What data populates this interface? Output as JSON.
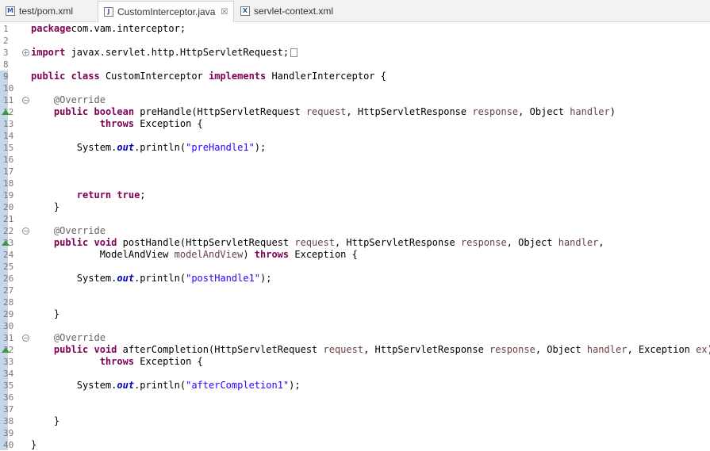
{
  "tabs": [
    {
      "label": "test/pom.xml",
      "icon": "maven-pom-icon",
      "active": false
    },
    {
      "label": "CustomInterceptor.java",
      "icon": "java-file-icon",
      "active": true,
      "close": "☒"
    },
    {
      "label": "servlet-context.xml",
      "icon": "xml-file-icon",
      "active": false
    }
  ],
  "editor": {
    "lines": [
      {
        "n": "1",
        "tokens": [
          [
            "kw",
            "package"
          ],
          [
            "",
            "com.vam.interceptor;"
          ]
        ]
      },
      {
        "n": "2",
        "tokens": []
      },
      {
        "n": "3",
        "fold": "expand",
        "tokens": [
          [
            "kw",
            "import"
          ],
          [
            "",
            " javax.servlet.http.HttpServletRequest;"
          ]
        ],
        "folded": true
      },
      {
        "n": "8",
        "tokens": []
      },
      {
        "n": "9",
        "tokens": [
          [
            "kw",
            "public"
          ],
          [
            "",
            " "
          ],
          [
            "kw",
            "class"
          ],
          [
            "",
            " CustomInterceptor "
          ],
          [
            "kw",
            "implements"
          ],
          [
            "",
            " HandlerInterceptor {"
          ]
        ]
      },
      {
        "n": "10",
        "tokens": []
      },
      {
        "n": "11",
        "fold": "collapse",
        "tokens": [
          [
            "",
            "    "
          ],
          [
            "ann",
            "@Override"
          ]
        ]
      },
      {
        "n": "12",
        "override": true,
        "tokens": [
          [
            "",
            "    "
          ],
          [
            "kw",
            "public"
          ],
          [
            "",
            " "
          ],
          [
            "kw",
            "boolean"
          ],
          [
            "",
            " preHandle(HttpServletRequest "
          ],
          [
            "param",
            "request"
          ],
          [
            "",
            ", HttpServletResponse "
          ],
          [
            "param",
            "response"
          ],
          [
            "",
            ", Object "
          ],
          [
            "param",
            "handler"
          ],
          [
            "",
            ")"
          ]
        ]
      },
      {
        "n": "13",
        "tokens": [
          [
            "",
            "            "
          ],
          [
            "kw",
            "throws"
          ],
          [
            "",
            " Exception {"
          ]
        ]
      },
      {
        "n": "14",
        "tokens": []
      },
      {
        "n": "15",
        "tokens": [
          [
            "",
            "        System."
          ],
          [
            "field",
            "out"
          ],
          [
            "",
            ".println("
          ],
          [
            "str",
            "\"preHandle1\""
          ],
          [
            "",
            ");"
          ]
        ]
      },
      {
        "n": "16",
        "tokens": []
      },
      {
        "n": "17",
        "tokens": []
      },
      {
        "n": "18",
        "tokens": []
      },
      {
        "n": "19",
        "tokens": [
          [
            "",
            "        "
          ],
          [
            "kw",
            "return"
          ],
          [
            "",
            " "
          ],
          [
            "kw",
            "true"
          ],
          [
            "",
            ";"
          ]
        ]
      },
      {
        "n": "20",
        "tokens": [
          [
            "",
            "    }"
          ]
        ]
      },
      {
        "n": "21",
        "tokens": []
      },
      {
        "n": "22",
        "fold": "collapse",
        "tokens": [
          [
            "",
            "    "
          ],
          [
            "ann",
            "@Override"
          ]
        ]
      },
      {
        "n": "23",
        "override": true,
        "tokens": [
          [
            "",
            "    "
          ],
          [
            "kw",
            "public"
          ],
          [
            "",
            " "
          ],
          [
            "kw",
            "void"
          ],
          [
            "",
            " postHandle(HttpServletRequest "
          ],
          [
            "param",
            "request"
          ],
          [
            "",
            ", HttpServletResponse "
          ],
          [
            "param",
            "response"
          ],
          [
            "",
            ", Object "
          ],
          [
            "param",
            "handler"
          ],
          [
            "",
            ","
          ]
        ]
      },
      {
        "n": "24",
        "tokens": [
          [
            "",
            "            ModelAndView "
          ],
          [
            "param",
            "modelAndView"
          ],
          [
            "",
            ") "
          ],
          [
            "kw",
            "throws"
          ],
          [
            "",
            " Exception {"
          ]
        ]
      },
      {
        "n": "25",
        "tokens": []
      },
      {
        "n": "26",
        "tokens": [
          [
            "",
            "        System."
          ],
          [
            "field",
            "out"
          ],
          [
            "",
            ".println("
          ],
          [
            "str",
            "\"postHandle1\""
          ],
          [
            "",
            ");"
          ]
        ]
      },
      {
        "n": "27",
        "tokens": []
      },
      {
        "n": "28",
        "tokens": []
      },
      {
        "n": "29",
        "tokens": [
          [
            "",
            "    }"
          ]
        ]
      },
      {
        "n": "30",
        "tokens": []
      },
      {
        "n": "31",
        "fold": "collapse",
        "tokens": [
          [
            "",
            "    "
          ],
          [
            "ann",
            "@Override"
          ]
        ]
      },
      {
        "n": "32",
        "override": true,
        "tokens": [
          [
            "",
            "    "
          ],
          [
            "kw",
            "public"
          ],
          [
            "",
            " "
          ],
          [
            "kw",
            "void"
          ],
          [
            "",
            " afterCompletion(HttpServletRequest "
          ],
          [
            "param",
            "request"
          ],
          [
            "",
            ", HttpServletResponse "
          ],
          [
            "param",
            "response"
          ],
          [
            "",
            ", Object "
          ],
          [
            "param",
            "handler"
          ],
          [
            "",
            ", Exception "
          ],
          [
            "param",
            "ex"
          ],
          [
            "",
            ")"
          ]
        ]
      },
      {
        "n": "33",
        "tokens": [
          [
            "",
            "            "
          ],
          [
            "kw",
            "throws"
          ],
          [
            "",
            " Exception {"
          ]
        ]
      },
      {
        "n": "34",
        "tokens": []
      },
      {
        "n": "35",
        "tokens": [
          [
            "",
            "        System."
          ],
          [
            "field",
            "out"
          ],
          [
            "",
            ".println("
          ],
          [
            "str",
            "\"afterCompletion1\""
          ],
          [
            "",
            ");"
          ]
        ]
      },
      {
        "n": "36",
        "tokens": []
      },
      {
        "n": "37",
        "tokens": []
      },
      {
        "n": "38",
        "tokens": [
          [
            "",
            "    }"
          ]
        ]
      },
      {
        "n": "39",
        "tokens": []
      },
      {
        "n": "40",
        "tokens": [
          [
            "",
            "}"
          ]
        ]
      }
    ]
  },
  "colors": {
    "keyword": "#7f0055",
    "annotation": "#646464",
    "parameter": "#6a3e3e",
    "string": "#2a00ff",
    "static_field": "#0000c0"
  }
}
